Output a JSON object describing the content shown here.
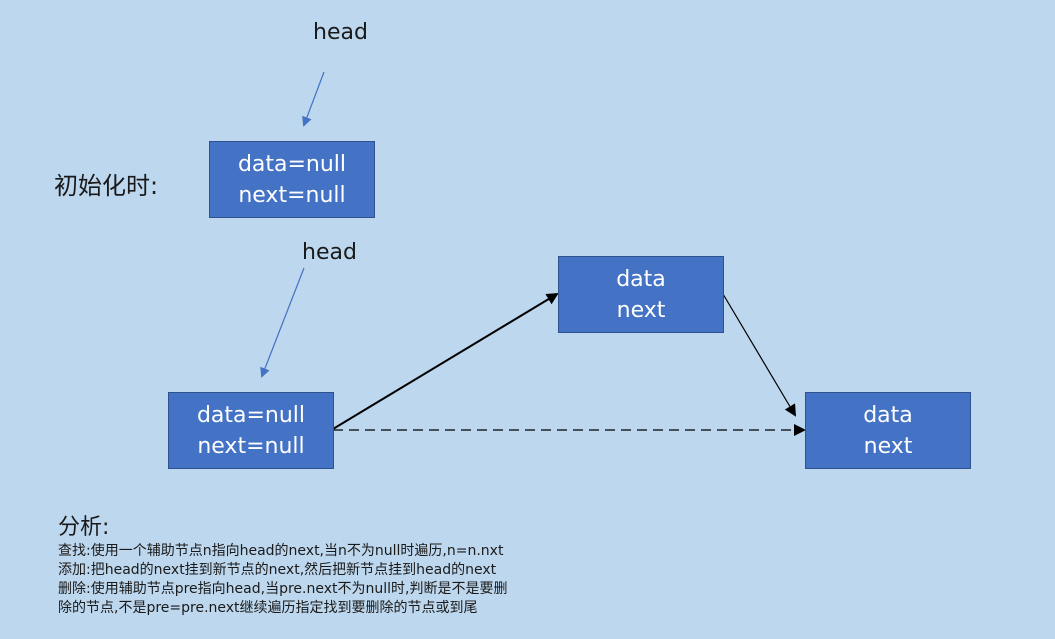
{
  "labels": {
    "head_top": "head",
    "head_bottom": "head",
    "init": "初始化时:"
  },
  "nodes": {
    "init_node": {
      "line1": "data=null",
      "line2": "next=null"
    },
    "head_node": {
      "line1": "data=null",
      "line2": "next=null"
    },
    "middle_node": {
      "line1": "data",
      "line2": "next"
    },
    "right_node": {
      "line1": "data",
      "line2": "next"
    }
  },
  "analysis": {
    "title": "分析:",
    "lines": [
      "查找:使用一个辅助节点n指向head的next,当n不为null时遍历,n=n.nxt",
      "添加:把head的next挂到新节点的next,然后把新节点挂到head的next",
      "删除:使用辅助节点pre指向head,当pre.next不为null时,判断是不是要删",
      "除的节点,不是pre=pre.next继续遍历指定找到要删除的节点或到尾"
    ]
  },
  "colors": {
    "background": "#bdd7ee",
    "node_fill": "#4472c4",
    "node_border": "#2f528f",
    "pointer_arrow": "#4472c4",
    "link_arrow": "#000000"
  }
}
